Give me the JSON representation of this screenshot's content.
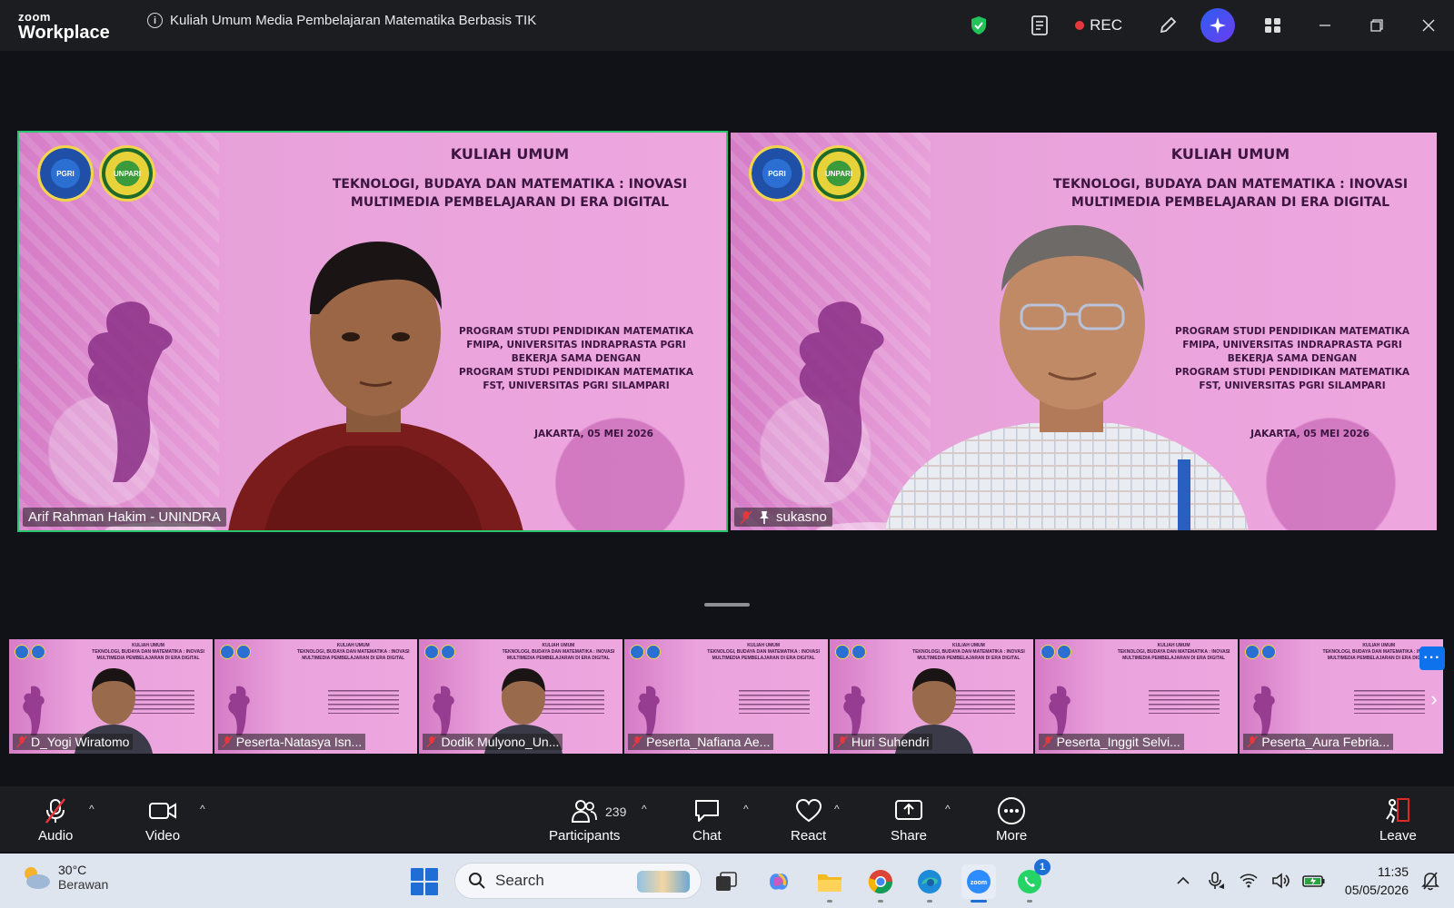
{
  "app": {
    "brand_top": "zoom",
    "brand_bottom": "Workplace",
    "meeting_title": "Kuliah Umum Media Pembelajaran Matematika Berbasis TIK",
    "rec_label": "REC"
  },
  "slide": {
    "title": "KULIAH UMUM",
    "subtitle_1": "TEKNOLOGI, BUDAYA DAN MATEMATIKA : INOVASI",
    "subtitle_2": "MULTIMEDIA PEMBELAJARAN DI ERA DIGITAL",
    "body_1": "PROGRAM STUDI PENDIDIKAN MATEMATIKA",
    "body_2": "FMIPA, UNIVERSITAS INDRAPRASTA PGRI",
    "body_3": "BEKERJA SAMA DENGAN",
    "body_4": "PROGRAM STUDI PENDIDIKAN MATEMATIKA",
    "body_5": "FST, UNIVERSITAS PGRI SILAMPARI",
    "date": "JAKARTA, 05 MEI 2026",
    "logo_1": "PGRI",
    "logo_2": "UNPARI"
  },
  "main_tiles": [
    {
      "name": "Arif Rahman Hakim - UNINDRA",
      "muted": false,
      "speaking": true
    },
    {
      "name": "sukasno",
      "muted": true,
      "pinned": true,
      "speaking": false
    }
  ],
  "thumbnails": [
    {
      "name": "D_Yogi Wiratomo",
      "has_face": true
    },
    {
      "name": "Peserta-Natasya Isn...",
      "has_face": false
    },
    {
      "name": "Dodik Mulyono_Un...",
      "has_face": true
    },
    {
      "name": "Peserta_Nafiana Ae...",
      "has_face": false
    },
    {
      "name": "Huri Suhendri",
      "has_face": true
    },
    {
      "name": "Peserta_Inggit Selvi...",
      "has_face": false
    },
    {
      "name": "Peserta_Aura Febria...",
      "has_face": false
    }
  ],
  "toolbar": {
    "audio": "Audio",
    "video": "Video",
    "participants": "Participants",
    "participant_count": "239",
    "chat": "Chat",
    "react": "React",
    "share": "Share",
    "more": "More",
    "leave": "Leave"
  },
  "taskbar": {
    "temperature": "30°C",
    "weather": "Berawan",
    "search_placeholder": "Search",
    "whatsapp_badge": "1",
    "time": "11:35",
    "date": "05/05/2026"
  },
  "colors": {
    "speaking_border": "#28c76f",
    "rec_dot": "#e8373c",
    "accent_blue": "#0e72ed",
    "leave_red": "#e02828"
  }
}
